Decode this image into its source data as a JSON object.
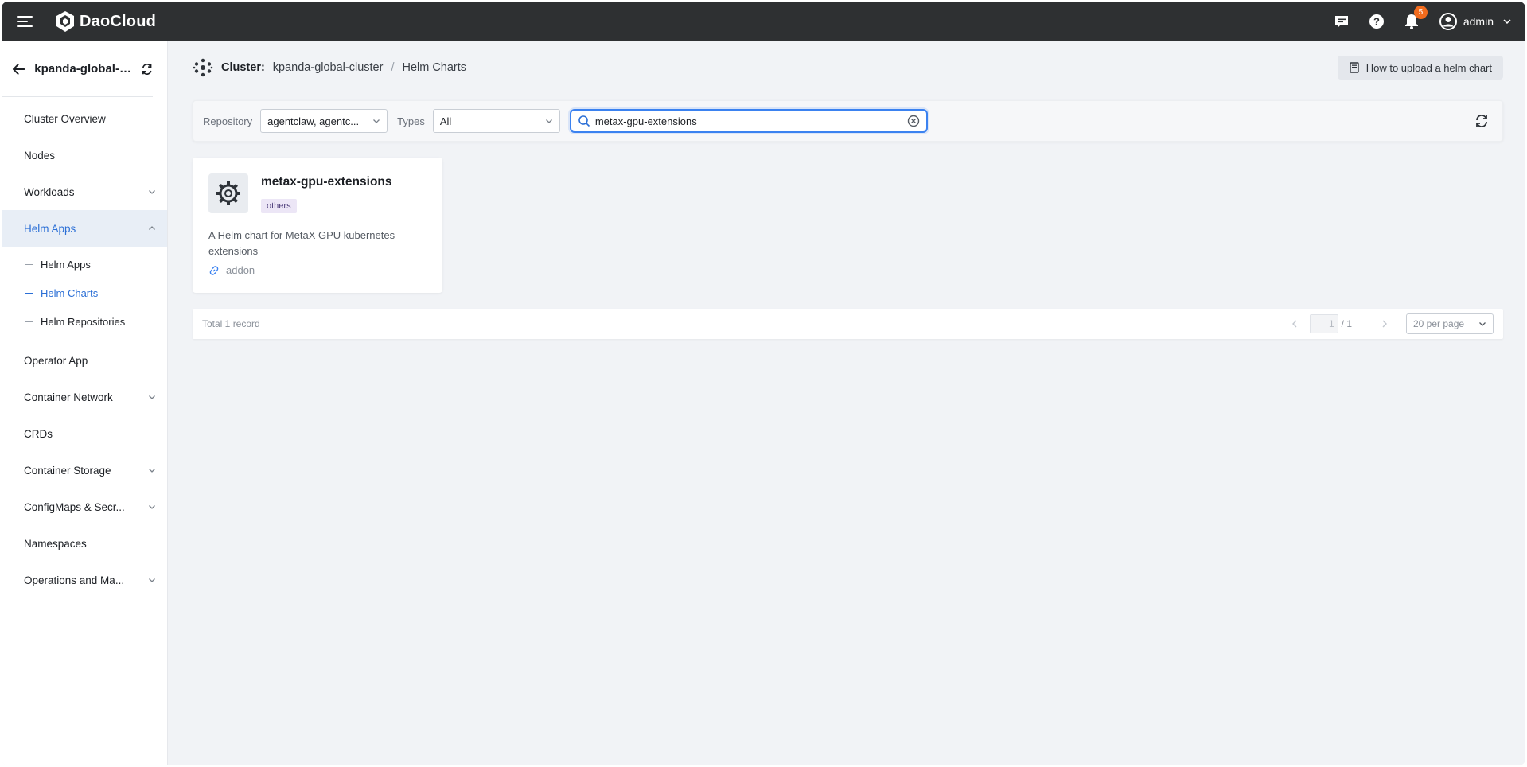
{
  "topbar": {
    "brand": "DaoCloud",
    "notification_count": "5",
    "user_name": "admin"
  },
  "sidebar": {
    "cluster_name": "kpanda-global-cl...",
    "items": [
      {
        "label": "Cluster Overview"
      },
      {
        "label": "Nodes"
      },
      {
        "label": "Workloads"
      },
      {
        "label": "Helm Apps"
      },
      {
        "label": "Operator App"
      },
      {
        "label": "Container Network"
      },
      {
        "label": "CRDs"
      },
      {
        "label": "Container Storage"
      },
      {
        "label": "ConfigMaps & Secr..."
      },
      {
        "label": "Namespaces"
      },
      {
        "label": "Operations and Ma..."
      }
    ],
    "helm_sub": [
      {
        "label": "Helm Apps"
      },
      {
        "label": "Helm Charts"
      },
      {
        "label": "Helm Repositories"
      }
    ]
  },
  "header": {
    "cluster_label": "Cluster:",
    "cluster_name": "kpanda-global-cluster",
    "separator": "/",
    "page": "Helm Charts",
    "help_button": "How to upload a helm chart"
  },
  "filters": {
    "repository_label": "Repository",
    "repository_value": "agentclaw, agentc...",
    "types_label": "Types",
    "types_value": "All",
    "search_value": "metax-gpu-extensions"
  },
  "card": {
    "title": "metax-gpu-extensions",
    "tag": "others",
    "description": "A Helm chart for MetaX GPU kubernetes extensions",
    "link": "addon"
  },
  "pager": {
    "total": "Total 1 record",
    "current": "1",
    "of_total": "/ 1",
    "per_page": "20 per page"
  },
  "colors": {
    "topbar": "#2e3032",
    "accent": "#2b6fd6",
    "badge": "#f26b1d"
  }
}
